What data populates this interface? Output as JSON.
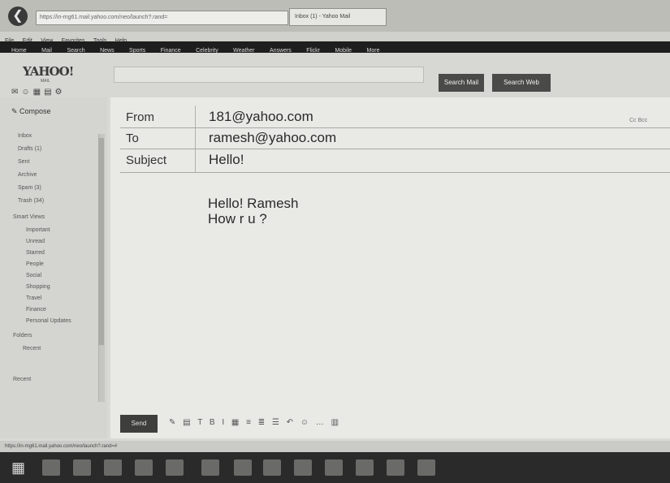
{
  "browser": {
    "back_icon": "back-arrow-icon",
    "address": "https://in-mg61.mail.yahoo.com/neo/launch?.rand=",
    "tab_title": "Inbox (1) - Yahoo Mail",
    "menu": [
      "File",
      "Edit",
      "View",
      "Favorites",
      "Tools",
      "Help"
    ],
    "nav_links": [
      "Home",
      "Mail",
      "Search",
      "News",
      "Sports",
      "Finance",
      "Celebrity",
      "Weather",
      "Answers",
      "Flickr",
      "Mobile",
      "More"
    ]
  },
  "header": {
    "logo": "YAHOO!",
    "logo_sub": "MAIL",
    "search_mail_label": "Search Mail",
    "search_web_label": "Search Web"
  },
  "sidebar": {
    "compose_label": "Compose",
    "folders": [
      "Inbox",
      "Drafts (1)",
      "Sent",
      "Archive",
      "Spam (3)",
      "Trash (34)",
      "Smart Views",
      "Important",
      "Unread",
      "Starred",
      "People",
      "Social",
      "Shopping",
      "Travel",
      "Finance",
      "Personal Updates",
      "Folders",
      "Recent",
      "Recent"
    ]
  },
  "compose": {
    "from_label": "From",
    "from_value": "181@yahoo.com",
    "to_label": "To",
    "to_value": "ramesh@yahoo.com",
    "subject_label": "Subject",
    "subject_value": "Hello!",
    "body_line1": "Hello! Ramesh",
    "body_line2": "How r u ?",
    "cc_label": "Cc Bcc",
    "send_label": "Send",
    "format_tools": "✎ ▤ T B I ▦ ≡ ≣ ☰ ↶ ☺ … ▥"
  },
  "statusbar": {
    "text": "https://in-mg61.mail.yahoo.com/neo/launch?.rand=#"
  }
}
